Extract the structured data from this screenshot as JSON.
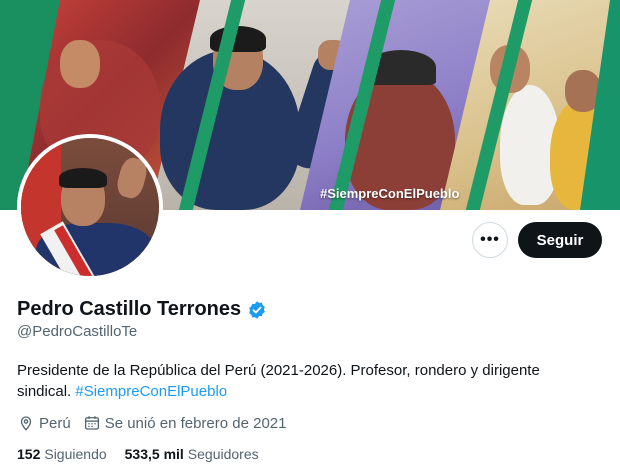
{
  "banner": {
    "hashtag": "#SiempreConElPueblo"
  },
  "actions": {
    "more_label": "•••",
    "follow_label": "Seguir"
  },
  "profile": {
    "name": "Pedro Castillo Terrones",
    "handle": "@PedroCastilloTe",
    "bio_text": "Presidente de la República del Perú (2021-2026). Profesor, rondero y dirigente sindical.",
    "bio_hashtag": "#SiempreConElPueblo",
    "location": "Perú",
    "joined": "Se unió en febrero de 2021"
  },
  "stats": {
    "following_count": "152",
    "following_label": "Siguiendo",
    "followers_count": "533,5 mil",
    "followers_label": "Seguidores"
  },
  "colors": {
    "accent": "#1d9bf0",
    "text": "#0f1419",
    "muted": "#536471",
    "banner_green": "#1a8f5f"
  },
  "icons": {
    "verified": "verified-badge-icon",
    "location": "location-pin-icon",
    "calendar": "calendar-icon",
    "more": "more-options-icon"
  }
}
